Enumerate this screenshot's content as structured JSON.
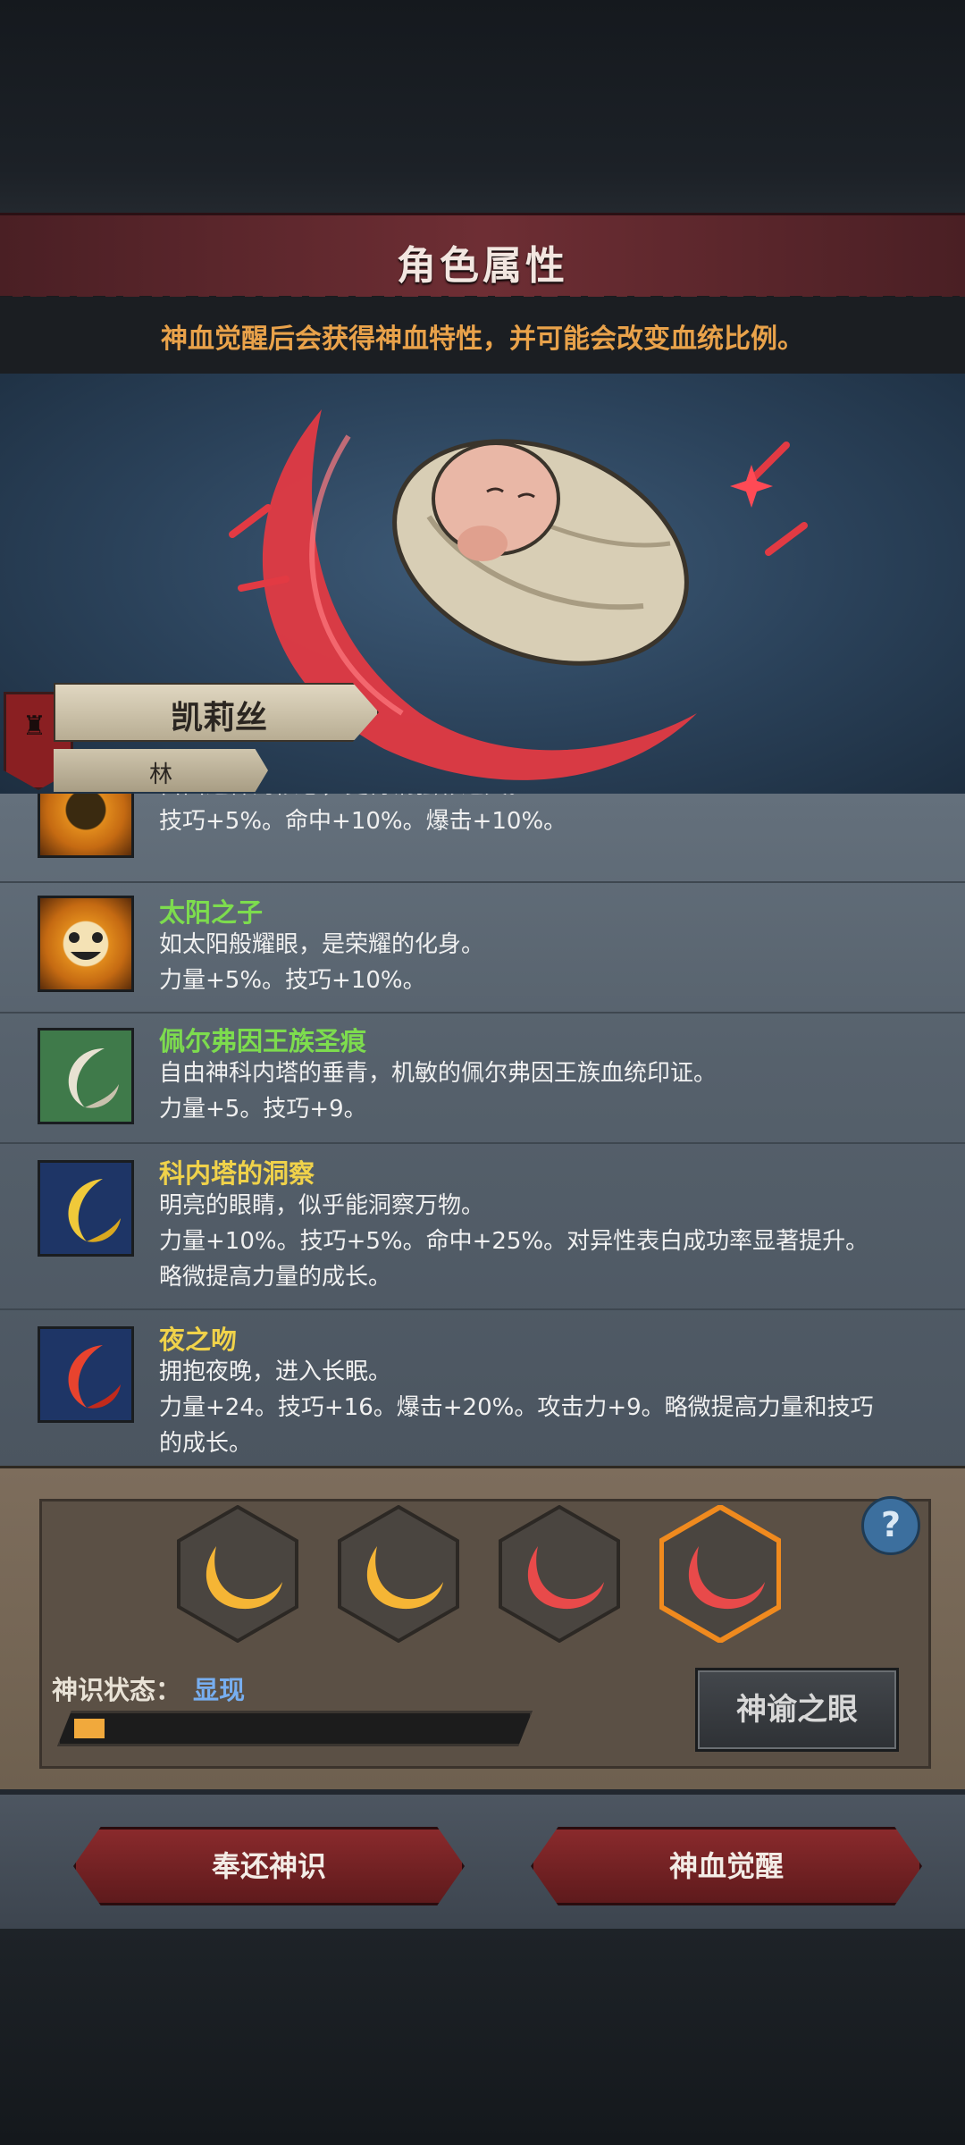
{
  "header": {
    "title": "角色属性",
    "subtitle": "神血觉醒后会获得神血特性，并可能会改变血统比例。"
  },
  "character": {
    "name": "凯莉丝",
    "house": "林"
  },
  "traits": [
    {
      "title": "",
      "desc": "自由之神的侬患，更待钢强彩之天。",
      "stats": "技巧+5%。命中+10%。爆击+10%。",
      "icon": "sun-icon",
      "title_color": "#7ddc4e"
    },
    {
      "title": "太阳之子",
      "desc": "如太阳般耀眼，是荣耀的化身。",
      "stats": "力量+5%。技巧+10%。",
      "icon": "smiling-sun-icon",
      "title_color": "#7ddc4e"
    },
    {
      "title": "佩尔弗因王族圣痕",
      "desc": "自由神科内塔的垂青，机敏的佩尔弗因王族血统印证。",
      "stats": "力量+5。技巧+9。",
      "icon": "white-crescent-icon",
      "title_color": "#7ddc4e"
    },
    {
      "title": "科内塔的洞察",
      "desc": "明亮的眼睛，似乎能洞察万物。",
      "stats": "力量+10%。技巧+5%。命中+25%。对异性表白成功率显著提升。",
      "extra": "略微提高力量的成长。",
      "icon": "yellow-crescent-icon",
      "title_color": "#f0d24a"
    },
    {
      "title": "夜之吻",
      "desc": "拥抱夜晚，进入长眠。",
      "stats": "力量+24。技巧+16。爆击+20%。攻击力+9。略微提高力量和技巧",
      "extra": "的成长。",
      "icon": "red-crescent-icon",
      "title_color": "#f0d24a"
    }
  ],
  "awakening": {
    "slots": [
      {
        "icon": "gold-crescent-icon",
        "color": "#f5b535"
      },
      {
        "icon": "gold-crescent-icon",
        "color": "#f5b535"
      },
      {
        "icon": "red-crescent-icon",
        "color": "#e84a4a"
      },
      {
        "icon": "red-crescent-icon",
        "color": "#e84a4a",
        "selected": true
      }
    ],
    "help": "?",
    "status_label": "神识状态：",
    "status_value": "显现",
    "progress": 0.07,
    "oracle_button": "神谕之眼"
  },
  "buttons": {
    "return": "奉还神识",
    "awaken": "神血觉醒"
  }
}
